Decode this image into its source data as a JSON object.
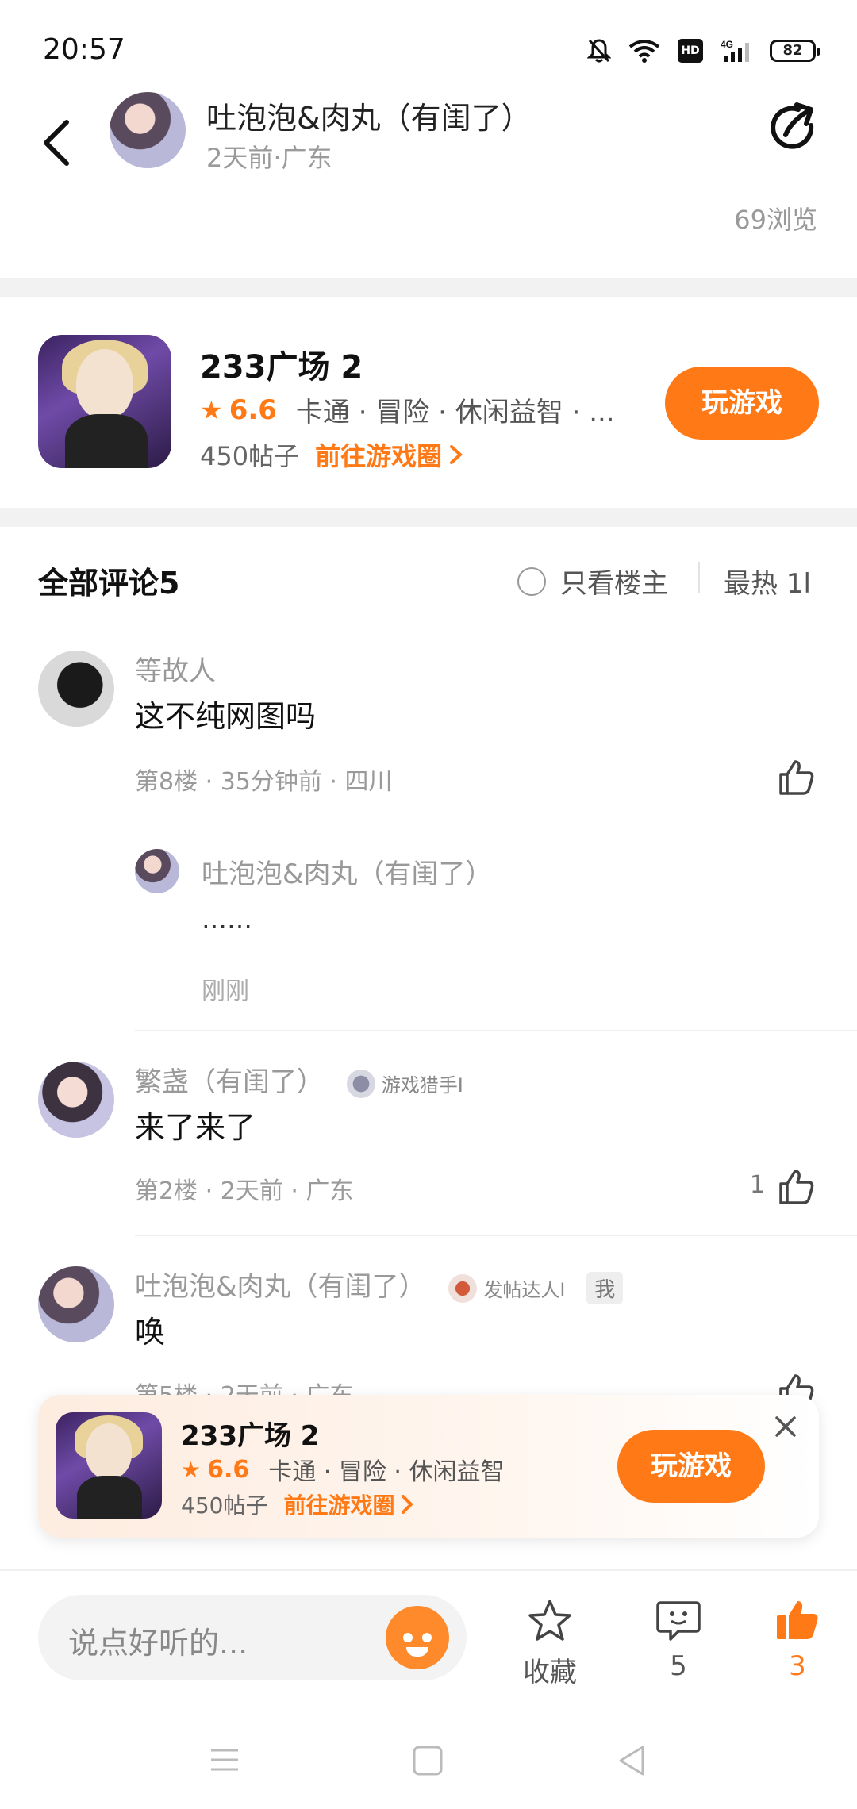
{
  "status_bar": {
    "time": "20:57",
    "battery": "82",
    "network": "4G",
    "hd": "HD"
  },
  "post": {
    "author_name": "吐泡泡&肉丸（有闺了）",
    "meta": "2天前·广东",
    "views": "69浏览"
  },
  "game": {
    "title": "233广场 2",
    "rating": "6.6",
    "tags": "卡通 · 冒险 · 休闲益智 · ...",
    "posts": "450帖子",
    "goto_label": "前往游戏圈",
    "play_label": "玩游戏"
  },
  "comments_header": {
    "title": "全部评论5",
    "only_op": "只看楼主",
    "sort": "最热 1l"
  },
  "comments": [
    {
      "name": "等故人",
      "text": "这不纯网图吗",
      "meta": "第8楼 · 35分钟前 · 四川",
      "likes": "",
      "reply": {
        "name": "吐泡泡&肉丸（有闺了）",
        "text": "……",
        "time": "刚刚"
      }
    },
    {
      "name": "繁盏（有闺了）",
      "badge": "游戏猎手I",
      "text": "来了来了",
      "meta": "第2楼 · 2天前 · 广东",
      "likes": "1"
    },
    {
      "name": "吐泡泡&肉丸（有闺了）",
      "badge": "发帖达人I",
      "me_tag": "我",
      "text": "唤",
      "meta": "第5楼 · 2天前 · 广东",
      "likes": ""
    }
  ],
  "floating_card": {
    "title": "233广场 2",
    "rating": "6.6",
    "tags": "卡通 · 冒险 · 休闲益智",
    "posts": "450帖子",
    "goto_label": "前往游戏圈",
    "play_label": "玩游戏"
  },
  "bottom_bar": {
    "input_placeholder": "说点好听的...",
    "favorite_label": "收藏",
    "comment_count": "5",
    "like_count": "3"
  },
  "colors": {
    "accent": "#ff7a17",
    "muted": "#9a9a9a",
    "text": "#111111"
  }
}
